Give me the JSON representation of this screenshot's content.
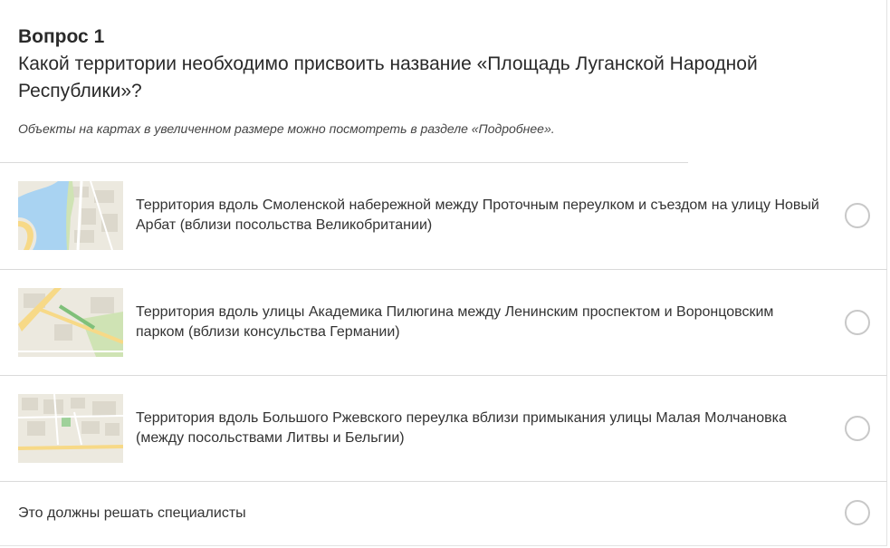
{
  "question": {
    "number": "Вопрос 1",
    "text": "Какой территории необходимо присвоить название «Площадь Луганской Народной Республики»?",
    "hint": "Объекты на картах в увеличенном размере можно посмотреть в разделе «Подробнее»."
  },
  "options": [
    {
      "label": "Территория вдоль Смоленской набережной между Проточным переулком и съездом на улицу Новый Арбат (вблизи посольства Великобритании)",
      "thumbnail": "map-thumbnail-river",
      "selected": false
    },
    {
      "label": "Территория вдоль улицы Академика Пилюгина между Ленинским проспектом и Воронцовским парком (вблизи консульства Германии)",
      "thumbnail": "map-thumbnail-avenue",
      "selected": false
    },
    {
      "label": "Территория вдоль Большого Ржевского переулка вблизи примыкания улицы Малая Молчановка (между посольствами Литвы и Бельгии)",
      "thumbnail": "map-thumbnail-streets",
      "selected": false
    },
    {
      "label": "Это должны решать специалисты",
      "thumbnail": "",
      "selected": false
    }
  ],
  "colors": {
    "map_base": "#ece9df",
    "map_water": "#a9d3f2",
    "map_green": "#cfe3b4",
    "map_road": "#f7d987",
    "radio_border": "#c8c8c8"
  }
}
